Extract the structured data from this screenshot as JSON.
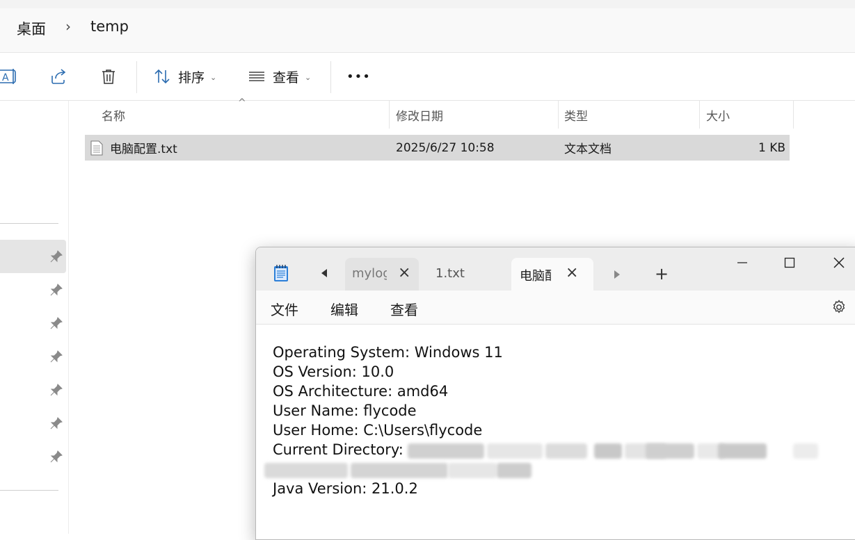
{
  "explorer": {
    "breadcrumb": [
      "桌面",
      "temp"
    ],
    "toolbar": {
      "sort_label": "排序",
      "view_label": "查看",
      "more_label": "•••"
    },
    "columns": {
      "name": "名称",
      "modified": "修改日期",
      "type": "类型",
      "size": "大小"
    },
    "files": [
      {
        "name": "电脑配置.txt",
        "modified": "2025/6/27 10:58",
        "type": "文本文档",
        "size": "1 KB"
      }
    ],
    "nav_pinned_count": 7
  },
  "notepad": {
    "tabs": [
      "mylog",
      "1.txt",
      "电脑配置.txt"
    ],
    "active_tab": 2,
    "new_tab_label": "+",
    "menu": [
      "文件",
      "编辑",
      "查看"
    ],
    "content": {
      "line1": "Operating System: Windows 11",
      "line2": "OS Version: 10.0",
      "line3": "OS Architecture: amd64",
      "line4": "User Name: flycode",
      "line5": "User Home: C:\\Users\\flycode",
      "line6": "Current Directory:",
      "line8": "Java Version: 21.0.2"
    },
    "icons": {
      "app": "notepad-icon",
      "settings": "gear-icon"
    }
  },
  "colors": {
    "selection": "#d9d9d9",
    "accent": "#2b6cb0",
    "notepad_icon": "#2b7fd8"
  }
}
